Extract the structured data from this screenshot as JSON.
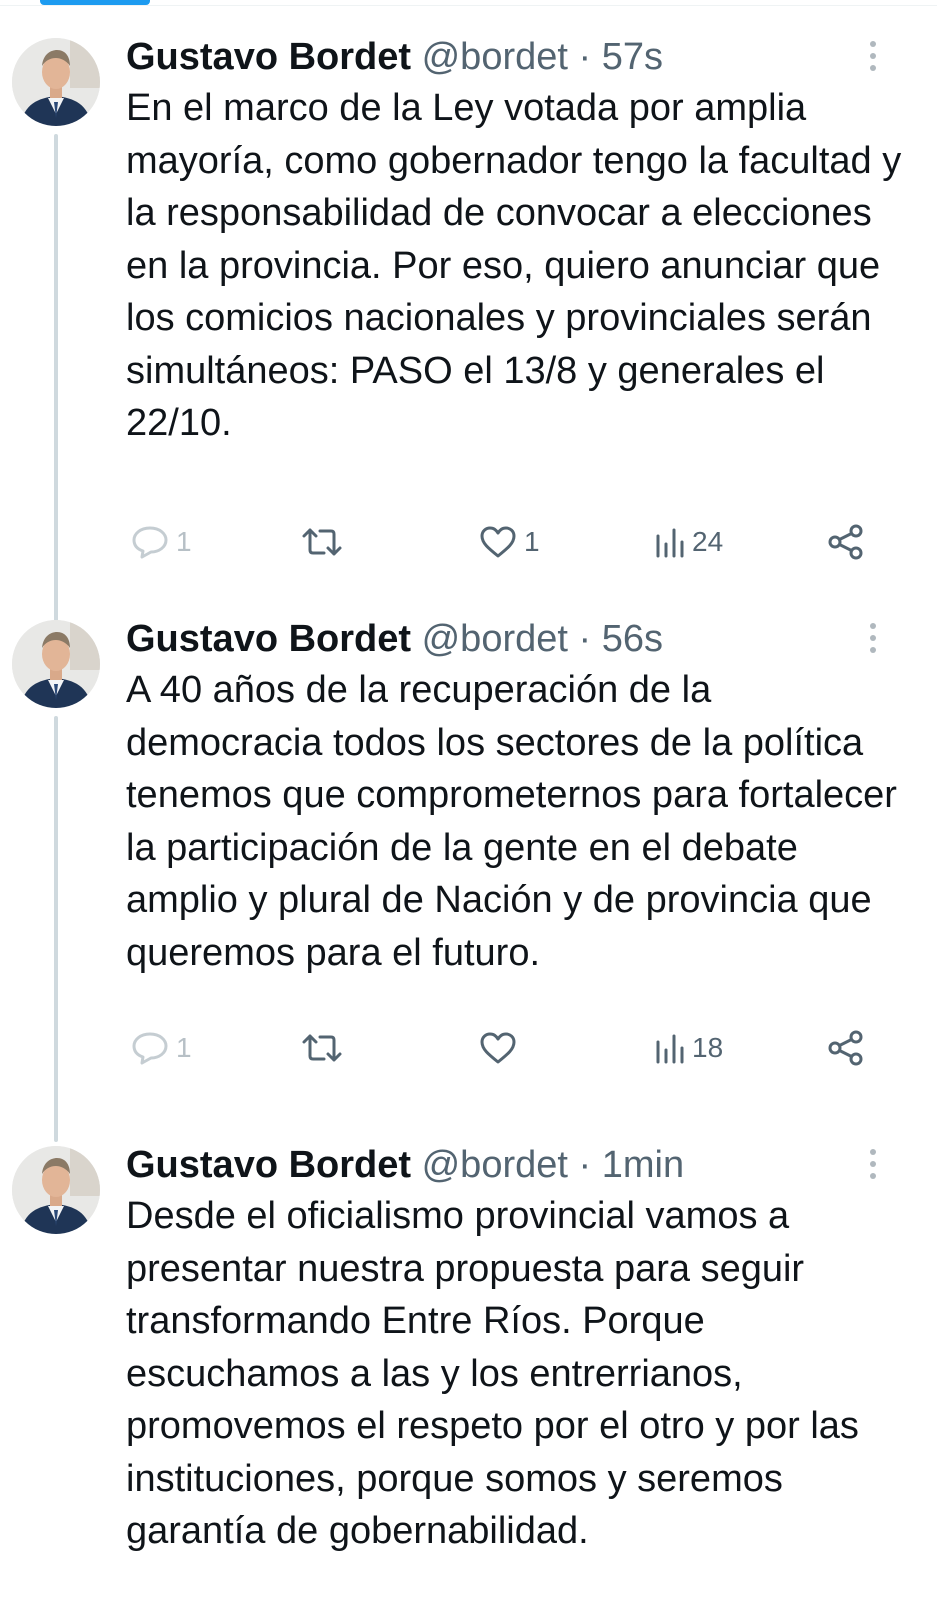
{
  "colors": {
    "accent": "#1d9bf0",
    "text_primary": "#0f1419",
    "text_secondary": "#536471",
    "thread_line": "#cfd9de"
  },
  "tweets": [
    {
      "author_name": "Gustavo Bordet",
      "handle": "@bordet",
      "separator": "·",
      "time": "57s",
      "text": "En el marco de la Ley votada por amplia mayoría, como gobernador tengo la facultad y la responsabilidad de convocar a elecciones en la provincia. Por eso, quiero anunciar que los comicios nacionales y provinciales serán simultáneos: PASO el 13/8 y generales el 22/10.",
      "actions": {
        "reply_count": "1",
        "retweet_count": "",
        "like_count": "1",
        "views_count": "24"
      },
      "icons": [
        "reply-icon",
        "retweet-icon",
        "like-icon",
        "views-icon",
        "share-icon",
        "more-icon"
      ]
    },
    {
      "author_name": "Gustavo Bordet",
      "handle": "@bordet",
      "separator": "·",
      "time": "56s",
      "text": "A 40 años de la recuperación de la democracia todos los sectores de la política tenemos que comprometernos para fortalecer la participación de la gente en el debate amplio y plural de Nación y de provincia que queremos para el futuro.",
      "actions": {
        "reply_count": "1",
        "retweet_count": "",
        "like_count": "",
        "views_count": "18"
      },
      "icons": [
        "reply-icon",
        "retweet-icon",
        "like-icon",
        "views-icon",
        "share-icon",
        "more-icon"
      ]
    },
    {
      "author_name": "Gustavo Bordet",
      "handle": "@bordet",
      "separator": "·",
      "time": "1min",
      "text": "Desde el oficialismo provincial vamos a presentar nuestra propuesta para seguir transformando Entre Ríos. Porque escuchamos a las y los entrerrianos, promovemos el respeto por el otro y por las instituciones, porque somos y seremos garantía de gobernabilidad.",
      "icons": [
        "more-icon"
      ]
    }
  ]
}
